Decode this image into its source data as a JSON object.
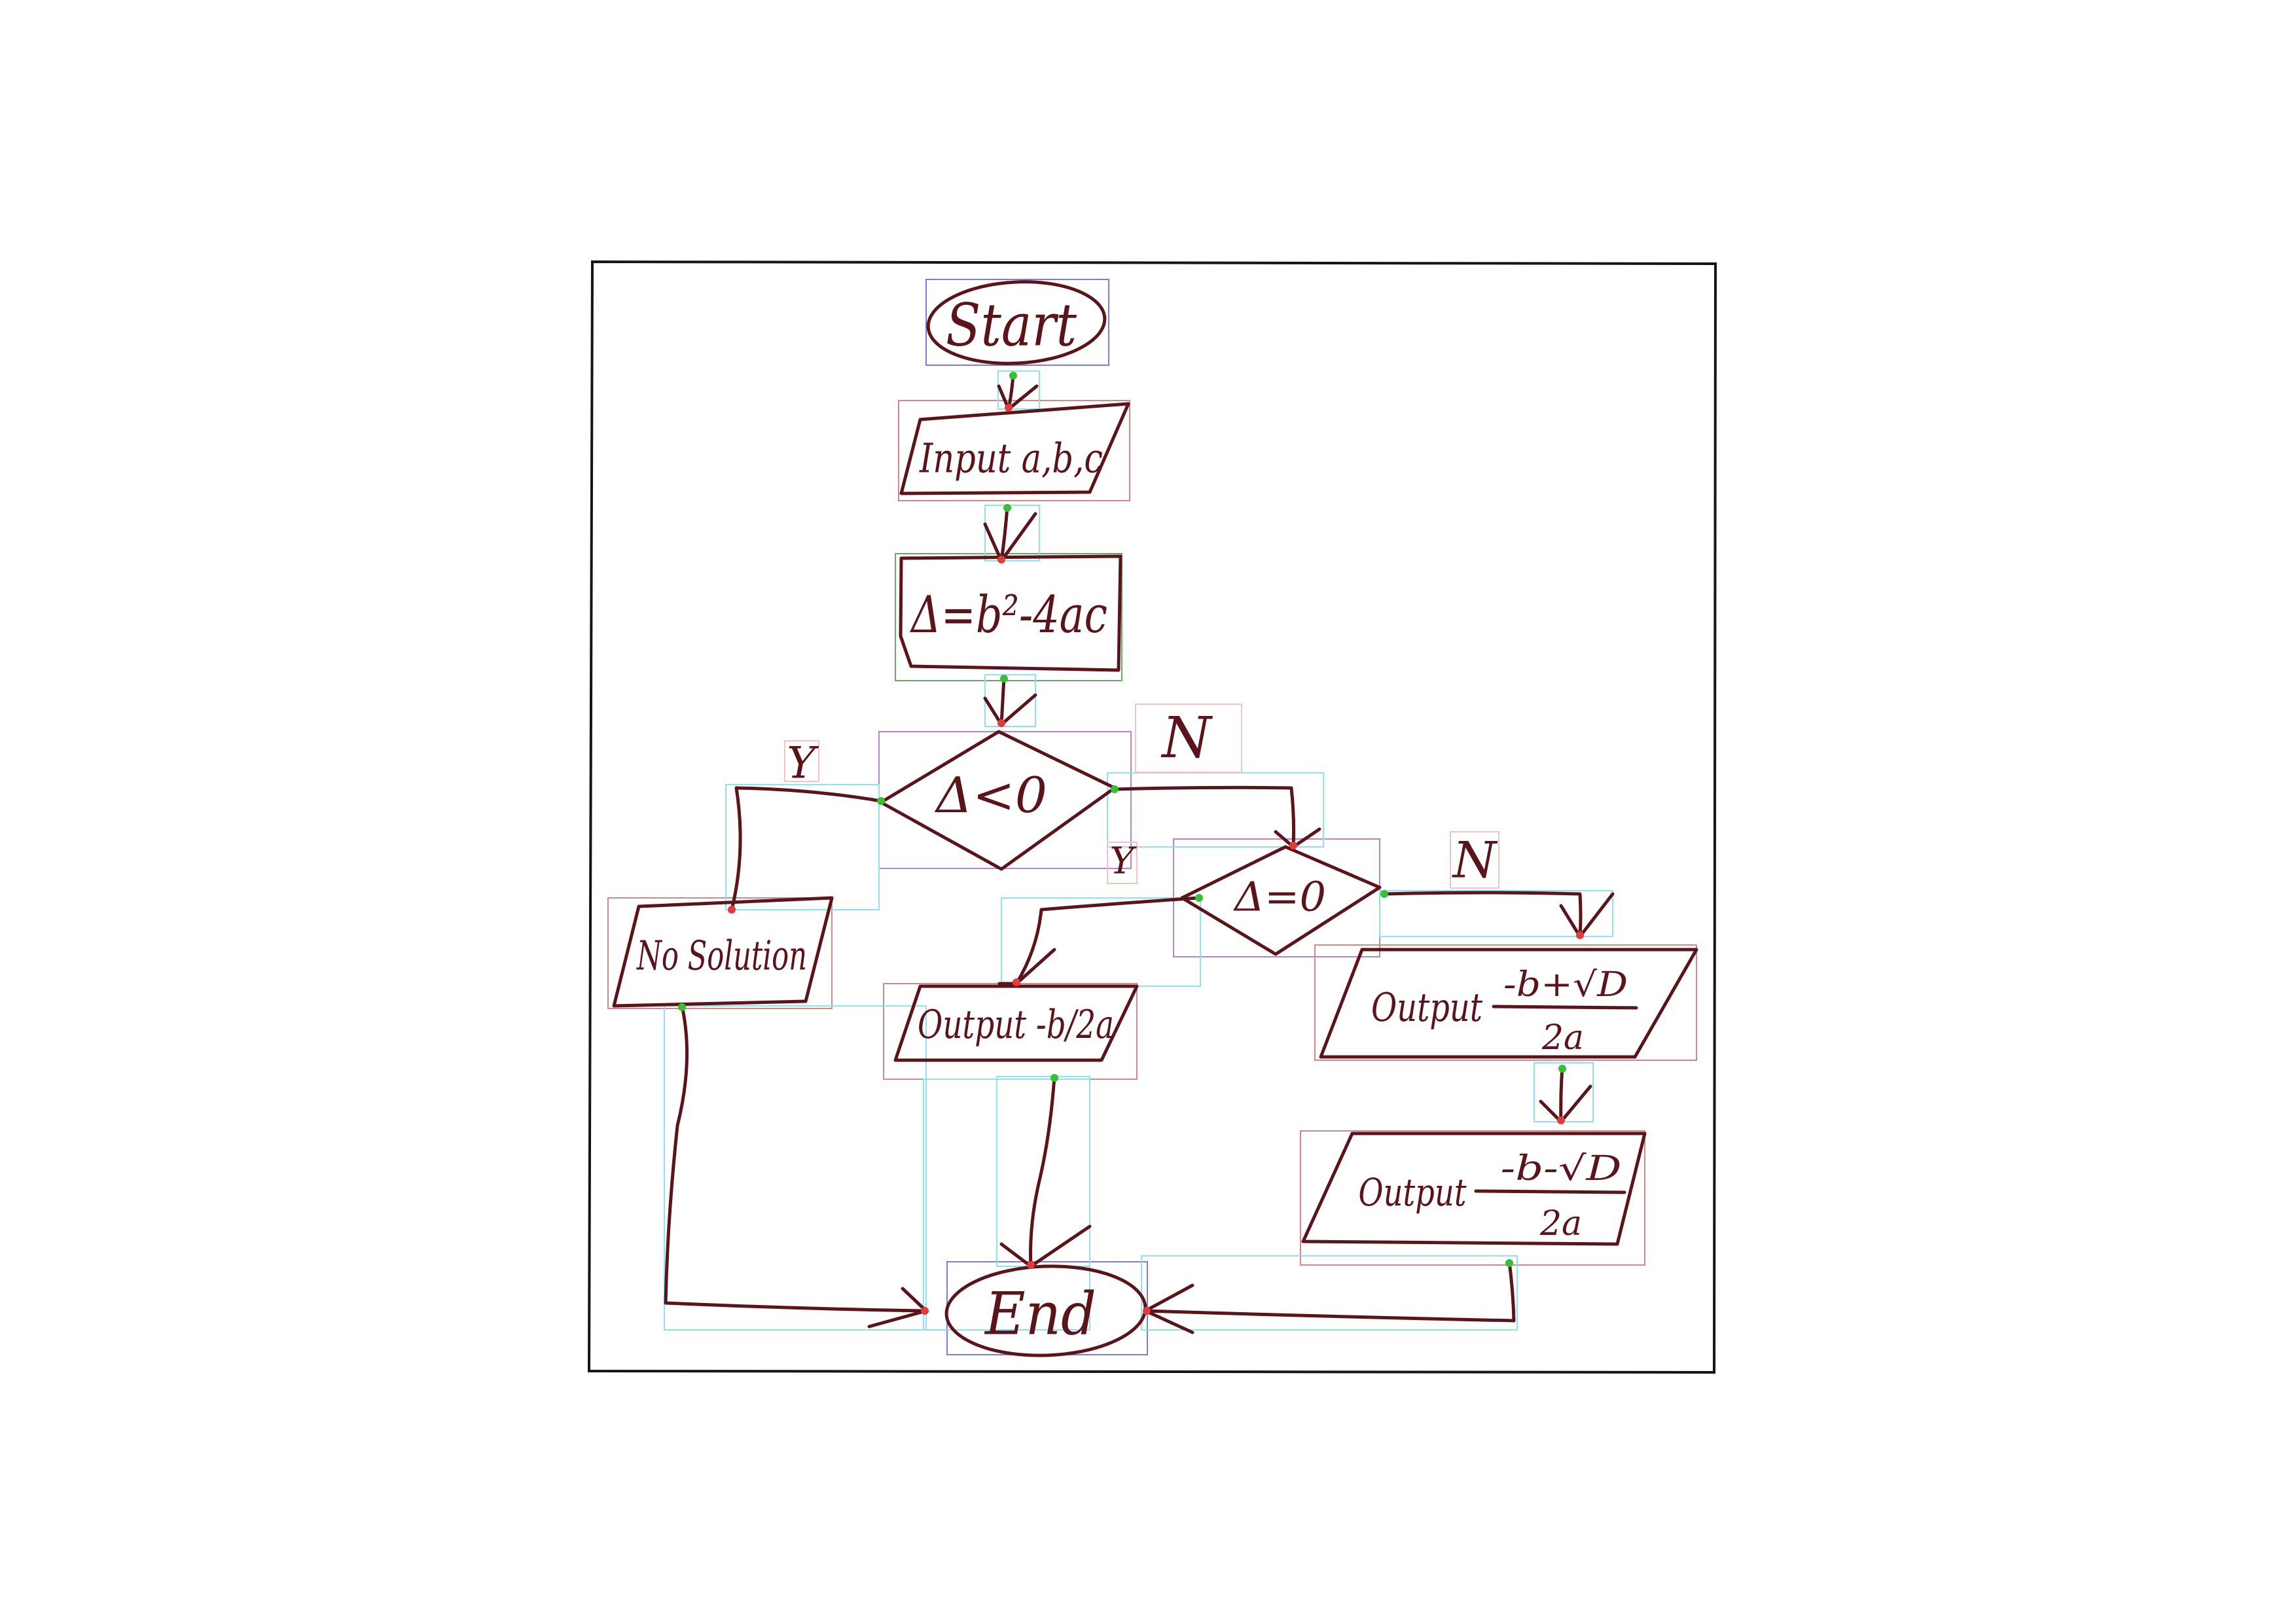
{
  "flowchart": {
    "nodes": {
      "start": "Start",
      "input": "Input a,b,c",
      "compute": "Δ=b²-4ac",
      "decision_negative": "Δ<0",
      "no_solution": "No Solution",
      "decision_zero": "Δ=0",
      "output_single": "Output -b/2a",
      "output_plus": {
        "prefix": "Output",
        "numerator": "-b+√D",
        "denominator": "2a"
      },
      "output_minus": {
        "prefix": "Output",
        "numerator": "-b-√D",
        "denominator": "2a"
      },
      "end": "End"
    },
    "edge_labels": {
      "negative_yes": "Y",
      "negative_no": "N",
      "zero_yes": "Y",
      "zero_no": "N"
    }
  },
  "colors": {
    "ink": "#5b1419",
    "frame": "#151515",
    "annotation_terminal": "#7b7be0",
    "annotation_io": "#cc8a8a",
    "annotation_process": "#6aa86a",
    "annotation_decision": "#b784cf",
    "annotation_arrow": "#8fe3ec",
    "annotation_label": "#f0c4cc",
    "arrow_head_dot": "#e23b3b",
    "arrow_tail_dot": "#35c035"
  }
}
